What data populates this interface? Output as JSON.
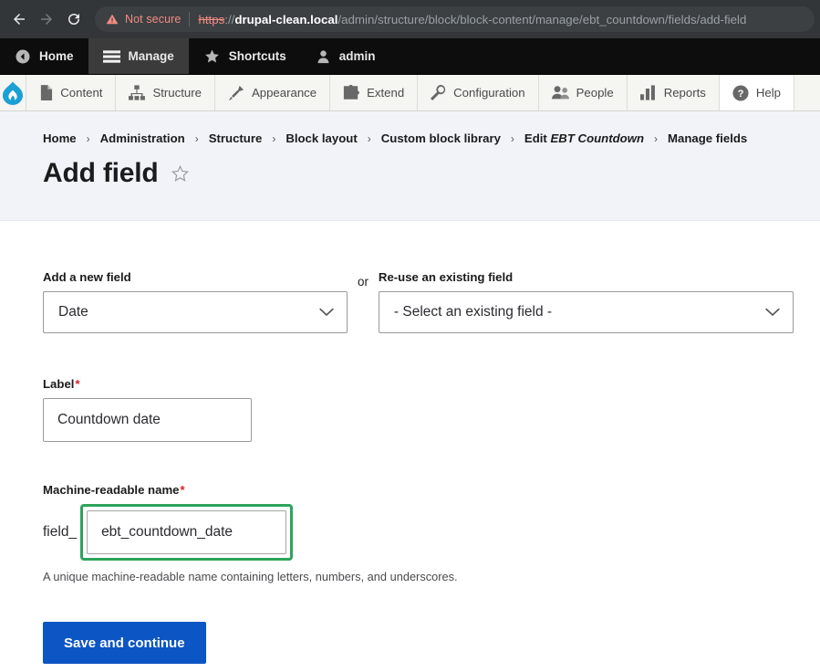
{
  "browser": {
    "back_label": "Back",
    "forward_label": "Forward",
    "reload_label": "Reload",
    "security_warning": "Not secure",
    "url_scheme": "https",
    "url_separator": "://",
    "url_host": "drupal-clean.local",
    "url_path": "/admin/structure/block/block-content/manage/ebt_countdown/fields/add-field"
  },
  "admin_toolbar": {
    "items": [
      {
        "label": "Home",
        "icon": "home-back-icon",
        "active": false
      },
      {
        "label": "Manage",
        "icon": "hamburger-icon",
        "active": true
      },
      {
        "label": "Shortcuts",
        "icon": "star-icon",
        "active": false
      },
      {
        "label": "admin",
        "icon": "user-icon",
        "active": false
      }
    ]
  },
  "menu_bar": {
    "logo": "drupal-logo",
    "items": [
      {
        "label": "Content",
        "icon": "document-icon",
        "active": false
      },
      {
        "label": "Structure",
        "icon": "structure-icon",
        "active": false
      },
      {
        "label": "Appearance",
        "icon": "paintbrush-icon",
        "active": false
      },
      {
        "label": "Extend",
        "icon": "puzzle-icon",
        "active": false
      },
      {
        "label": "Configuration",
        "icon": "wrench-icon",
        "active": false
      },
      {
        "label": "People",
        "icon": "people-icon",
        "active": false
      },
      {
        "label": "Reports",
        "icon": "bar-chart-icon",
        "active": false
      },
      {
        "label": "Help",
        "icon": "question-circle-icon",
        "active": true
      }
    ]
  },
  "header": {
    "breadcrumb": [
      {
        "text": "Home",
        "italic": false
      },
      {
        "text": "Administration",
        "italic": false
      },
      {
        "text": "Structure",
        "italic": false
      },
      {
        "text": "Block layout",
        "italic": false
      },
      {
        "text": "Custom block library",
        "italic": false
      },
      {
        "text": "Edit EBT Countdown",
        "prefix": "Edit ",
        "italic_part": "EBT Countdown",
        "italic": true
      },
      {
        "text": "Manage fields",
        "italic": false
      }
    ],
    "separator": "›",
    "title": "Add field",
    "bookmark_icon": "star-outline-icon"
  },
  "form": {
    "add_new_field": {
      "label": "Add a new field",
      "selected_value": "Date",
      "required": false
    },
    "or_text": "or",
    "reuse_field": {
      "label": "Re-use an existing field",
      "selected_value": "- Select an existing field -",
      "required": false
    },
    "label_field": {
      "label": "Label",
      "required_marker": "*",
      "value": "Countdown date"
    },
    "machine_name_field": {
      "label": "Machine-readable name",
      "required_marker": "*",
      "prefix": "field_",
      "value": "ebt_countdown_date",
      "description": "A unique machine-readable name containing letters, numbers, and underscores.",
      "highlight_color": "#2ea35a"
    },
    "submit_label": "Save and continue",
    "submit_color": "#0c55c4"
  }
}
